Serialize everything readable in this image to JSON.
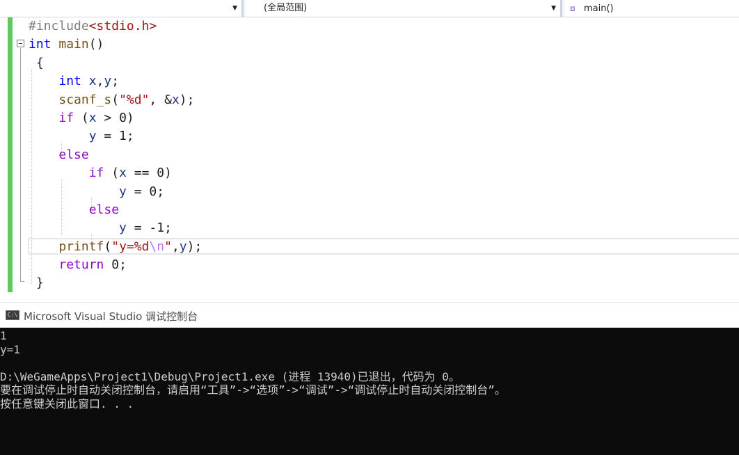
{
  "navbar": {
    "project_selector": "",
    "scope_selector": "(全局范围)",
    "member_selector": "main()",
    "member_icon": "cube-method-icon",
    "dropdown_icon": "triangle-down-icon"
  },
  "editor": {
    "lines": [
      [
        {
          "t": "#include",
          "c": "pp"
        },
        {
          "t": "<stdio.h>",
          "c": "inc"
        }
      ],
      [
        {
          "t": "int",
          "c": "kw"
        },
        {
          "t": " "
        },
        {
          "t": "main",
          "c": "fn"
        },
        {
          "t": "()"
        }
      ],
      [
        {
          "t": " {"
        }
      ],
      [
        {
          "t": "    "
        },
        {
          "t": "int",
          "c": "kw"
        },
        {
          "t": " "
        },
        {
          "t": "x",
          "c": "var"
        },
        {
          "t": ","
        },
        {
          "t": "y",
          "c": "var"
        },
        {
          "t": ";"
        }
      ],
      [
        {
          "t": "    "
        },
        {
          "t": "scanf_s",
          "c": "fn"
        },
        {
          "t": "("
        },
        {
          "t": "\"%d\"",
          "c": "str"
        },
        {
          "t": ", &"
        },
        {
          "t": "x",
          "c": "var"
        },
        {
          "t": ");"
        }
      ],
      [
        {
          "t": "    "
        },
        {
          "t": "if",
          "c": "kw2"
        },
        {
          "t": " ("
        },
        {
          "t": "x",
          "c": "var"
        },
        {
          "t": " > 0)"
        }
      ],
      [
        {
          "t": "        "
        },
        {
          "t": "y",
          "c": "var"
        },
        {
          "t": " = 1;"
        }
      ],
      [
        {
          "t": "    "
        },
        {
          "t": "else",
          "c": "kw2"
        }
      ],
      [
        {
          "t": "        "
        },
        {
          "t": "if",
          "c": "kw2"
        },
        {
          "t": " ("
        },
        {
          "t": "x",
          "c": "var"
        },
        {
          "t": " == 0)"
        }
      ],
      [
        {
          "t": "            "
        },
        {
          "t": "y",
          "c": "var"
        },
        {
          "t": " = 0;"
        }
      ],
      [
        {
          "t": "        "
        },
        {
          "t": "else",
          "c": "kw2"
        }
      ],
      [
        {
          "t": "            "
        },
        {
          "t": "y",
          "c": "var"
        },
        {
          "t": " = -1;"
        }
      ],
      [
        {
          "t": "    "
        },
        {
          "t": "printf",
          "c": "fn"
        },
        {
          "t": "("
        },
        {
          "t": "\"y=%d",
          "c": "str"
        },
        {
          "t": "\\n",
          "c": "esc"
        },
        {
          "t": "\"",
          "c": "str"
        },
        {
          "t": ","
        },
        {
          "t": "y",
          "c": "var"
        },
        {
          "t": ");"
        }
      ],
      [
        {
          "t": "    "
        },
        {
          "t": "return",
          "c": "kw2"
        },
        {
          "t": " 0;"
        }
      ],
      [
        {
          "t": " }"
        }
      ]
    ],
    "colors": {
      "keyword_type": "#0000ff",
      "keyword_control": "#8f08c4",
      "preprocessor": "#808080",
      "string": "#a31515",
      "escape": "#b776fb",
      "function": "#74531f",
      "variable": "#1f377f",
      "change_bar": "#5fc95f"
    }
  },
  "console": {
    "title": "Microsoft Visual Studio 调试控制台",
    "icon_label": "C:\\",
    "lines": [
      "1",
      "y=1",
      "",
      "D:\\WeGameApps\\Project1\\Debug\\Project1.exe (进程 13940)已退出，代码为 0。",
      "要在调试停止时自动关闭控制台，请启用“工具”->“选项”->“调试”->“调试停止时自动关闭控制台”。",
      "按任意键关闭此窗口. . ."
    ]
  }
}
